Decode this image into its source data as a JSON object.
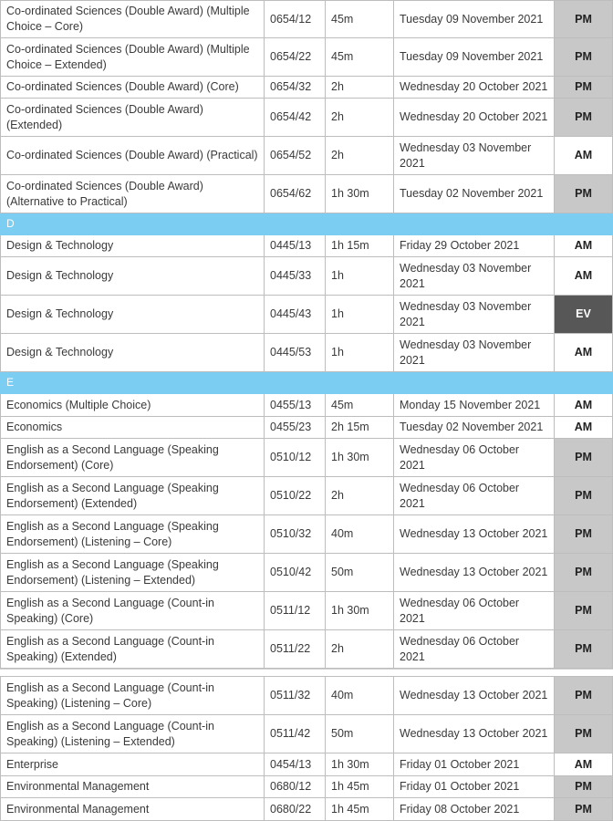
{
  "colors": {
    "letter_header": "#7ccdf2",
    "session_pm": "#c8c8c8",
    "session_am": "#ffffff",
    "session_ev": "#575757"
  },
  "tables": [
    {
      "rows": [
        {
          "subject": "Co-ordinated Sciences (Double Award) (Multiple Choice – Core)",
          "code": "0654/12",
          "duration": "45m",
          "date": "Tuesday 09 November 2021",
          "session": "PM"
        },
        {
          "subject": "Co-ordinated Sciences (Double Award) (Multiple Choice – Extended)",
          "code": "0654/22",
          "duration": "45m",
          "date": "Tuesday 09 November 2021",
          "session": "PM"
        },
        {
          "subject": "Co-ordinated Sciences (Double Award) (Core)",
          "code": "0654/32",
          "duration": "2h",
          "date": "Wednesday 20 October 2021",
          "session": "PM"
        },
        {
          "subject": "Co-ordinated Sciences (Double Award) (Extended)",
          "code": "0654/42",
          "duration": "2h",
          "date": "Wednesday 20 October 2021",
          "session": "PM"
        },
        {
          "subject": "Co-ordinated Sciences (Double Award) (Practical)",
          "code": "0654/52",
          "duration": "2h",
          "date": "Wednesday 03 November 2021",
          "session": "AM"
        },
        {
          "subject": "Co-ordinated Sciences (Double Award) (Alternative to Practical)",
          "code": "0654/62",
          "duration": "1h 30m",
          "date": "Tuesday 02 November 2021",
          "session": "PM"
        },
        {
          "letter": "D"
        },
        {
          "subject": "Design & Technology",
          "code": "0445/13",
          "duration": "1h 15m",
          "date": "Friday 29 October 2021",
          "session": "AM"
        },
        {
          "subject": "Design & Technology",
          "code": "0445/33",
          "duration": "1h",
          "date": "Wednesday 03 November 2021",
          "session": "AM"
        },
        {
          "subject": "Design & Technology",
          "code": "0445/43",
          "duration": "1h",
          "date": "Wednesday 03 November 2021",
          "session": "EV"
        },
        {
          "subject": "Design & Technology",
          "code": "0445/53",
          "duration": "1h",
          "date": "Wednesday 03 November 2021",
          "session": "AM"
        },
        {
          "letter": "E"
        },
        {
          "subject": "Economics (Multiple Choice)",
          "code": "0455/13",
          "duration": "45m",
          "date": "Monday 15 November 2021",
          "session": "AM"
        },
        {
          "subject": "Economics",
          "code": "0455/23",
          "duration": "2h 15m",
          "date": "Tuesday 02 November 2021",
          "session": "AM"
        },
        {
          "subject": "English as a Second Language (Speaking Endorsement) (Core)",
          "code": "0510/12",
          "duration": "1h 30m",
          "date": "Wednesday 06 October 2021",
          "session": "PM"
        },
        {
          "subject": "English as a Second Language (Speaking Endorsement) (Extended)",
          "code": "0510/22",
          "duration": "2h",
          "date": "Wednesday 06 October 2021",
          "session": "PM"
        },
        {
          "subject": "English as a Second Language (Speaking Endorsement) (Listening – Core)",
          "code": "0510/32",
          "duration": "40m",
          "date": "Wednesday 13 October 2021",
          "session": "PM"
        },
        {
          "subject": "English as a Second Language (Speaking Endorsement) (Listening – Extended)",
          "code": "0510/42",
          "duration": "50m",
          "date": "Wednesday 13 October 2021",
          "session": "PM"
        },
        {
          "subject": "English as a Second Language (Count-in Speaking) (Core)",
          "code": "0511/12",
          "duration": "1h 30m",
          "date": "Wednesday 06 October 2021",
          "session": "PM"
        },
        {
          "subject": "English as a Second Language (Count-in Speaking) (Extended)",
          "code": "0511/22",
          "duration": "2h",
          "date": "Wednesday 06 October 2021",
          "session": "PM"
        }
      ]
    },
    {
      "rows": [
        {
          "subject": "English as a Second Language (Count-in Speaking) (Listening – Core)",
          "code": "0511/32",
          "duration": "40m",
          "date": "Wednesday 13 October 2021",
          "session": "PM"
        },
        {
          "subject": "English as a Second Language (Count-in Speaking) (Listening – Extended)",
          "code": "0511/42",
          "duration": "50m",
          "date": "Wednesday 13 October 2021",
          "session": "PM"
        },
        {
          "subject": "Enterprise",
          "code": "0454/13",
          "duration": "1h 30m",
          "date": "Friday 01 October 2021",
          "session": "AM"
        },
        {
          "subject": "Environmental Management",
          "code": "0680/12",
          "duration": "1h 45m",
          "date": "Friday 01 October 2021",
          "session": "PM"
        },
        {
          "subject": "Environmental Management",
          "code": "0680/22",
          "duration": "1h 45m",
          "date": "Friday 08 October 2021",
          "session": "PM"
        }
      ]
    }
  ]
}
